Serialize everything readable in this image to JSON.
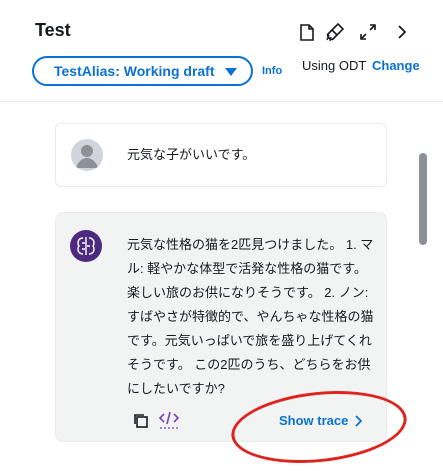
{
  "header": {
    "title": "Test",
    "alias_label": "TestAlias: Working draft",
    "info_label": "Info",
    "odt_text": "Using ODT",
    "change_label": "Change",
    "icons": [
      "document-icon",
      "brush-icon",
      "expand-icon",
      "chevron-right-icon"
    ]
  },
  "conversation": {
    "user_message": "元気な子がいいです。",
    "bot_message": "元気な性格の猫を2匹見つけました。 1. マル: 軽やかな体型で活発な性格の猫です。楽しい旅のお供になりそうです。 2. ノン: すばやさが特徴的で、やんちゃな性格の猫です。元気いっぱいで旅を盛り上げてくれそうです。 この2匹のうち、どちらをお供にしたいですか?",
    "show_trace_label": "Show trace"
  },
  "colors": {
    "accent": "#0972d3",
    "annotation": "#e0231c",
    "bot_avatar": "#4b2a80"
  }
}
